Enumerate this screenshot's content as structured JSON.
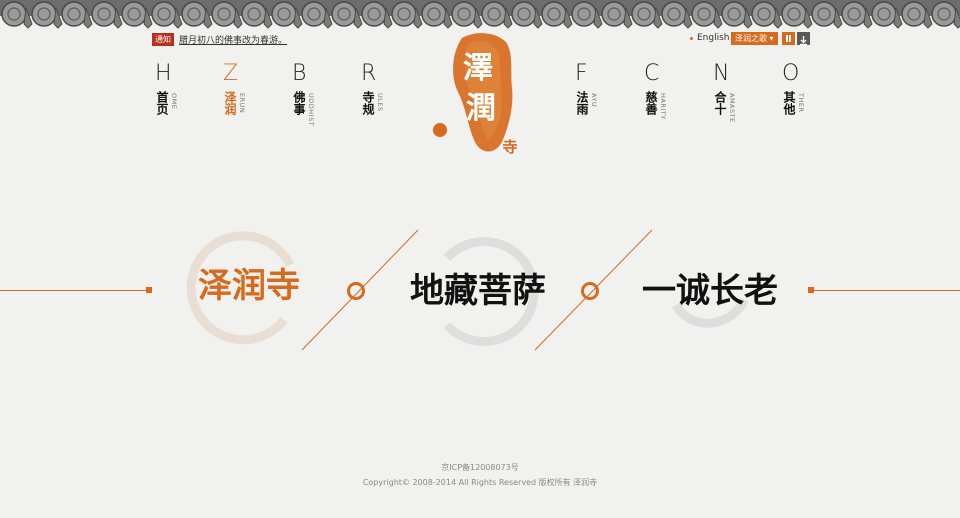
{
  "notice": {
    "tag": "通知",
    "text": "腊月初八的佛事改为春游。"
  },
  "header": {
    "lang": "English",
    "song": "泽润之歌 ▾"
  },
  "nav": {
    "left": [
      {
        "letter": "H",
        "cn": "首页",
        "en": "OME"
      },
      {
        "letter": "Z",
        "cn": "泽润",
        "en": "ERUN"
      },
      {
        "letter": "B",
        "cn": "佛事",
        "en": "UDDHIST"
      },
      {
        "letter": "R",
        "cn": "寺规",
        "en": "ULES"
      }
    ],
    "right": [
      {
        "letter": "F",
        "cn": "法雨",
        "en": "AYU"
      },
      {
        "letter": "C",
        "cn": "慈善",
        "en": "HARITY"
      },
      {
        "letter": "N",
        "cn": "合十",
        "en": "AMASTE"
      },
      {
        "letter": "O",
        "cn": "其他",
        "en": "THER"
      }
    ]
  },
  "logo": {
    "main1": "澤",
    "main2": "潤",
    "sub": "寺"
  },
  "features": [
    {
      "label": "泽润寺"
    },
    {
      "label": "地藏菩萨"
    },
    {
      "label": "一诚长老"
    }
  ],
  "footer": {
    "icp": "京ICP备12008073号",
    "copyright": "Copyright© 2008-2014 All Rights Reserved 版权所有 泽润寺"
  },
  "colors": {
    "accent": "#d86a1e",
    "notice": "#b72f1e",
    "background": "#f1f1ef"
  }
}
